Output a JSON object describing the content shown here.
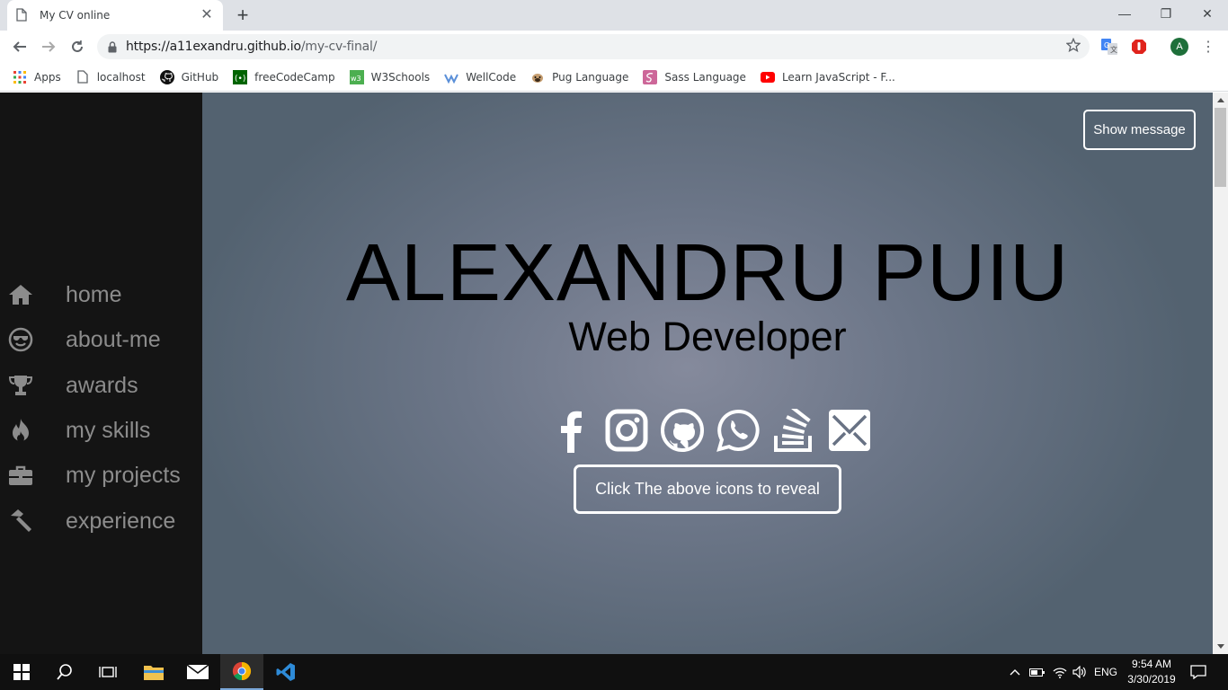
{
  "browser": {
    "tab_title": "My CV online",
    "tab_close": "✕",
    "new_tab": "+",
    "url_host": "https://a11exandru.github.io",
    "url_path": "/my-cv-final/",
    "profile_initial": "A",
    "menu": "⋮",
    "window": {
      "minimize": "—",
      "restore": "❐",
      "close": "✕"
    }
  },
  "bookmarks": [
    {
      "label": "Apps",
      "icon": "apps-grid-icon"
    },
    {
      "label": "localhost",
      "icon": "page-icon"
    },
    {
      "label": "GitHub",
      "icon": "github-icon"
    },
    {
      "label": "freeCodeCamp",
      "icon": "freecodecamp-icon"
    },
    {
      "label": "W3Schools",
      "icon": "w3schools-icon"
    },
    {
      "label": "WellCode",
      "icon": "wellcode-icon"
    },
    {
      "label": "Pug Language",
      "icon": "pug-icon"
    },
    {
      "label": "Sass Language",
      "icon": "sass-icon"
    },
    {
      "label": "Learn JavaScript - F...",
      "icon": "youtube-icon"
    }
  ],
  "sidebar": {
    "items": [
      {
        "label": "home",
        "icon": "home-icon"
      },
      {
        "label": "about-me",
        "icon": "smile-sunglasses-icon"
      },
      {
        "label": "awards",
        "icon": "trophy-icon"
      },
      {
        "label": "my skills",
        "icon": "fire-icon"
      },
      {
        "label": "my projects",
        "icon": "briefcase-icon"
      },
      {
        "label": "experience",
        "icon": "hammer-icon"
      }
    ]
  },
  "hero": {
    "show_message": "Show message",
    "name": "ALEXANDRU PUIU",
    "role": "Web Developer",
    "socials": [
      "facebook-icon",
      "instagram-icon",
      "github-icon",
      "whatsapp-icon",
      "stackoverflow-icon",
      "mail-icon"
    ],
    "reveal_button": "Click The above icons to reveal"
  },
  "taskbar": {
    "time": "9:54 AM",
    "date": "3/30/2019",
    "language": "ENG"
  },
  "colors": {
    "sidebar_bg": "#141414",
    "sidebar_text": "#8c8c8c",
    "hero_center": "#858a9c",
    "hero_edge": "#536270"
  }
}
